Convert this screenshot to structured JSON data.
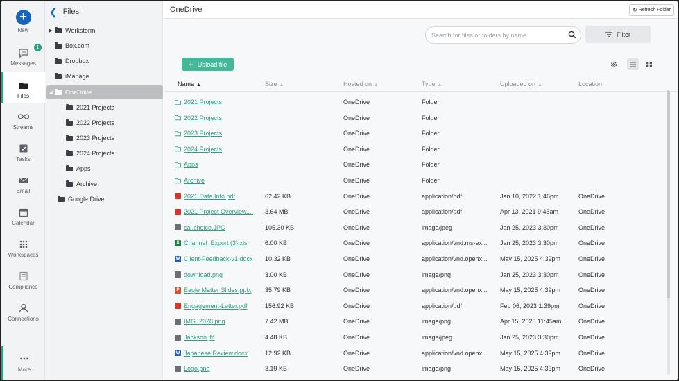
{
  "rail": {
    "new_label": "New",
    "messages_label": "Messages",
    "messages_badge": "1",
    "files_label": "Files",
    "streams_label": "Streams",
    "tasks_label": "Tasks",
    "email_label": "Email",
    "calendar_label": "Calendar",
    "workspaces_label": "Workspaces",
    "compliance_label": "Compliance",
    "connections_label": "Connections",
    "more_label": "More"
  },
  "tree": {
    "title": "Files",
    "nodes": [
      {
        "label": "Workstorm"
      },
      {
        "label": "Box.com"
      },
      {
        "label": "Dropbox"
      },
      {
        "label": "iManage"
      },
      {
        "label": "OneDrive"
      },
      {
        "label": "2021 Projects"
      },
      {
        "label": "2022 Projects"
      },
      {
        "label": "2023 Projects"
      },
      {
        "label": "2024 Projects"
      },
      {
        "label": "Apps"
      },
      {
        "label": "Archive"
      },
      {
        "label": "Google Drive"
      }
    ]
  },
  "main": {
    "title": "OneDrive",
    "refresh_label": "Refresh Folder",
    "search_placeholder": "Search for files or folders by name",
    "filter_label": "Filter",
    "upload_label": "Upload file"
  },
  "columns": {
    "name": "Name",
    "size": "Size",
    "hosted": "Hosted on",
    "type": "Type",
    "uploaded": "Uploaded on",
    "location": "Location"
  },
  "rows": [
    {
      "icon": "folder",
      "name": "2021 Projects",
      "size": "",
      "host": "OneDrive",
      "type": "Folder",
      "uploaded": "",
      "location": ""
    },
    {
      "icon": "folder",
      "name": "2022 Projects",
      "size": "",
      "host": "OneDrive",
      "type": "Folder",
      "uploaded": "",
      "location": ""
    },
    {
      "icon": "folder",
      "name": "2023 Projects",
      "size": "",
      "host": "OneDrive",
      "type": "Folder",
      "uploaded": "",
      "location": ""
    },
    {
      "icon": "folder",
      "name": "2024 Projects",
      "size": "",
      "host": "OneDrive",
      "type": "Folder",
      "uploaded": "",
      "location": ""
    },
    {
      "icon": "folder",
      "name": "Apps",
      "size": "",
      "host": "OneDrive",
      "type": "Folder",
      "uploaded": "",
      "location": ""
    },
    {
      "icon": "folder",
      "name": "Archive",
      "size": "",
      "host": "OneDrive",
      "type": "Folder",
      "uploaded": "",
      "location": ""
    },
    {
      "icon": "pdf",
      "name": "2021 Data Info.pdf",
      "size": "62.42 KB",
      "host": "OneDrive",
      "type": "application/pdf",
      "uploaded": "Jan 10, 2022 1:46pm",
      "location": "OneDrive"
    },
    {
      "icon": "pdf",
      "name": "2021 Project Overview....",
      "size": "3.64 MB",
      "host": "OneDrive",
      "type": "application/pdf",
      "uploaded": "Apr 13, 2021 9:45am",
      "location": "OneDrive"
    },
    {
      "icon": "img",
      "name": "cal.choice.JPG",
      "size": "105.30 KB",
      "host": "OneDrive",
      "type": "image/jpeg",
      "uploaded": "Jan 25, 2023 3:30pm",
      "location": "OneDrive"
    },
    {
      "icon": "xls",
      "name": "Channel_Export (3).xls",
      "size": "6.00 KB",
      "host": "OneDrive",
      "type": "application/vnd.ms-ex...",
      "uploaded": "Jan 25, 2023 3:30pm",
      "location": "OneDrive"
    },
    {
      "icon": "doc",
      "name": "Client-Feedback-v1.docx",
      "size": "10.32 KB",
      "host": "OneDrive",
      "type": "application/vnd.openx...",
      "uploaded": "May 15, 2025 4:39pm",
      "location": "OneDrive"
    },
    {
      "icon": "img",
      "name": "download.png",
      "size": "3.00 KB",
      "host": "OneDrive",
      "type": "image/png",
      "uploaded": "Jan 25, 2023 3:30pm",
      "location": "OneDrive"
    },
    {
      "icon": "ppt",
      "name": "Eagle Matter Slides.pptx",
      "size": "35.79 KB",
      "host": "OneDrive",
      "type": "application/vnd.openx...",
      "uploaded": "May 15, 2025 4:39pm",
      "location": "OneDrive"
    },
    {
      "icon": "pdf",
      "name": "Engagement-Letter.pdf",
      "size": "156.92 KB",
      "host": "OneDrive",
      "type": "application/pdf",
      "uploaded": "Feb 06, 2023 1:39pm",
      "location": "OneDrive"
    },
    {
      "icon": "img",
      "name": "IMG_2028.png",
      "size": "7.42 MB",
      "host": "OneDrive",
      "type": "image/png",
      "uploaded": "Apr 15, 2025 11:45am",
      "location": "OneDrive"
    },
    {
      "icon": "img",
      "name": "Jackson.jfif",
      "size": "4.48 KB",
      "host": "OneDrive",
      "type": "image/jpeg",
      "uploaded": "Jan 25, 2023 3:30pm",
      "location": "OneDrive"
    },
    {
      "icon": "doc",
      "name": "Japanese Review.docx",
      "size": "12.92 KB",
      "host": "OneDrive",
      "type": "application/vnd.openx...",
      "uploaded": "May 15, 2025 4:39pm",
      "location": "OneDrive"
    },
    {
      "icon": "img",
      "name": "Logo.png",
      "size": "3.19 KB",
      "host": "OneDrive",
      "type": "image/png",
      "uploaded": "May 15, 2025 4:39pm",
      "location": "OneDrive"
    }
  ],
  "colors": {
    "accent": "#2e9e85",
    "brand_blue": "#1565c0",
    "upload_green": "#43b99a"
  }
}
